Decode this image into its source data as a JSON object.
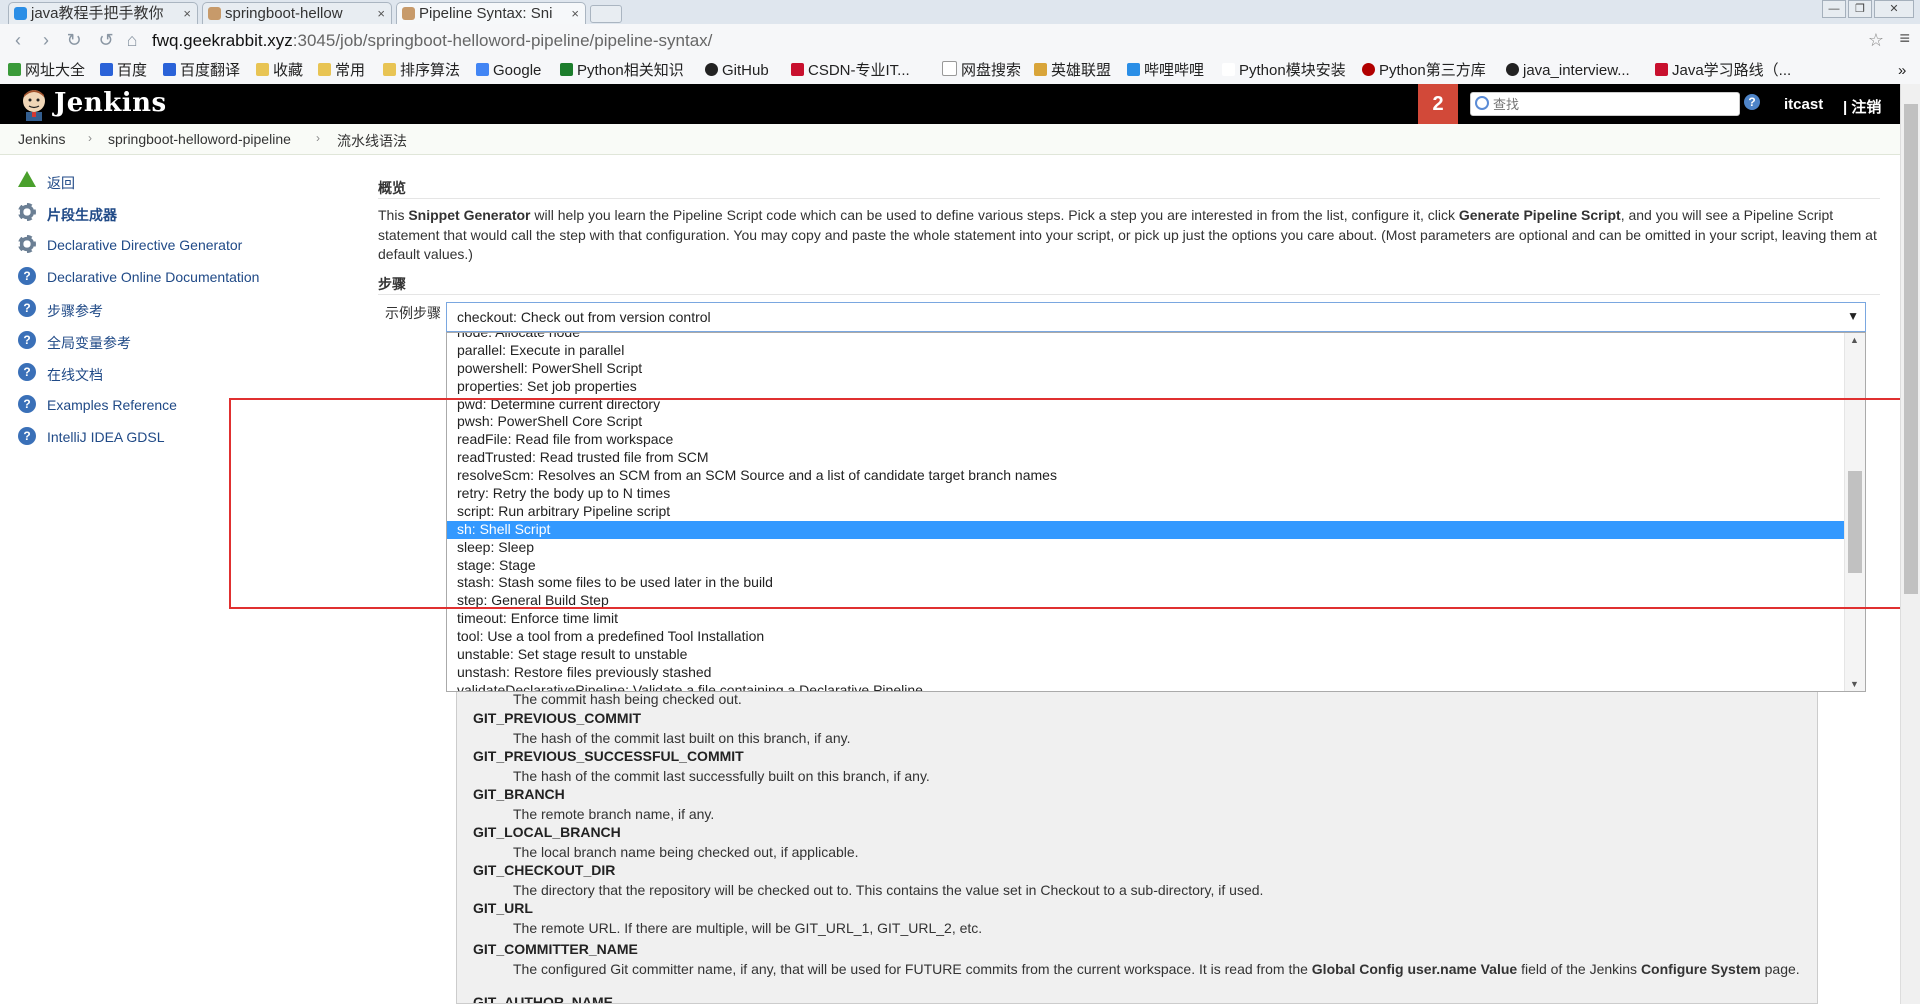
{
  "browser": {
    "tabs": [
      {
        "title": "java教程手把手教你"
      },
      {
        "title": "springboot-hellow"
      },
      {
        "title": "Pipeline Syntax: Sni"
      }
    ],
    "tab_close": "×",
    "url_host": "fwq.geekrabbit.xyz",
    "url_path": ":3045/job/springboot-helloword-pipeline/pipeline-syntax/",
    "bookmarks": [
      "网址大全",
      "百度",
      "百度翻译",
      "收藏",
      "常用",
      "排序算法",
      "Google",
      "Python相关知识",
      "GitHub",
      "CSDN-专业IT...",
      "网盘搜索",
      "英雄联盟",
      "哔哩哔哩",
      "Python模块安装",
      "Python第三方库",
      "java_interview...",
      "Java学习路线（..."
    ],
    "more": "»"
  },
  "header": {
    "title": "Jenkins",
    "notification_count": "2",
    "search_placeholder": "查找",
    "help": "?",
    "user": "itcast",
    "logout": "| 注销"
  },
  "breadcrumbs": [
    "Jenkins",
    "springboot-helloword-pipeline",
    "流水线语法"
  ],
  "sidebar": {
    "items": [
      {
        "label": "返回"
      },
      {
        "label": "片段生成器"
      },
      {
        "label": "Declarative Directive Generator"
      },
      {
        "label": "Declarative Online Documentation"
      },
      {
        "label": "步骤参考"
      },
      {
        "label": "全局变量参考"
      },
      {
        "label": "在线文档"
      },
      {
        "label": "Examples Reference"
      },
      {
        "label": "IntelliJ IDEA GDSL"
      }
    ]
  },
  "main": {
    "overview_heading": "概览",
    "desc_1": "This ",
    "desc_b1": "Snippet Generator",
    "desc_2": " will help you learn the Pipeline Script code which can be used to define various steps. Pick a step you are interested in from the list, configure it, click ",
    "desc_b2": "Generate Pipeline Script",
    "desc_3": ", and you will see a Pipeline Script statement that would call the step with that configuration. You may copy and paste the whole statement into your script, or pick up just the options you care about. (Most parameters are optional and can be omitted in your script, leaving them at default values.)",
    "steps_heading": "步骤",
    "step_label": "示例步骤",
    "selected_step": "checkout: Check out from version control",
    "dropdown_arrow": "▼",
    "dropdown_items": [
      "node: Allocate node",
      "parallel: Execute in parallel",
      "powershell: PowerShell Script",
      "properties: Set job properties",
      "pwd: Determine current directory",
      "pwsh: PowerShell Core Script",
      "readFile: Read file from workspace",
      "readTrusted: Read trusted file from SCM",
      "resolveScm: Resolves an SCM from an SCM Source and a list of candidate target branch names",
      "retry: Retry the body up to N times",
      "script: Run arbitrary Pipeline script",
      "sh: Shell Script",
      "sleep: Sleep",
      "stage: Stage",
      "stash: Stash some files to be used later in the build",
      "step: General Build Step",
      "timeout: Enforce time limit",
      "tool: Use a tool from a predefined Tool Installation",
      "unstable: Set stage result to unstable",
      "unstash: Restore files previously stashed",
      "validateDeclarativePipeline: Validate a file containing a Declarative Pipeline"
    ],
    "highlighted_item": "sh: Shell Script"
  },
  "help_vars": {
    "first_desc": "The commit hash being checked out.",
    "items": [
      {
        "name": "GIT_PREVIOUS_COMMIT",
        "desc": "The hash of the commit last built on this branch, if any."
      },
      {
        "name": "GIT_PREVIOUS_SUCCESSFUL_COMMIT",
        "desc": "The hash of the commit last successfully built on this branch, if any."
      },
      {
        "name": "GIT_BRANCH",
        "desc": "The remote branch name, if any."
      },
      {
        "name": "GIT_LOCAL_BRANCH",
        "desc": "The local branch name being checked out, if applicable."
      },
      {
        "name": "GIT_CHECKOUT_DIR",
        "desc": "The directory that the repository will be checked out to. This contains the value set in Checkout to a sub-directory, if used."
      },
      {
        "name": "GIT_URL",
        "desc": "The remote URL. If there are multiple, will be GIT_URL_1, GIT_URL_2, etc."
      }
    ],
    "committer_name": "GIT_COMMITTER_NAME",
    "committer_desc_1": "The configured Git committer name, if any, that will be used for FUTURE commits from the current workspace. It is read from the ",
    "committer_desc_b1": "Global Config user.name Value",
    "committer_desc_2": " field of the Jenkins ",
    "committer_desc_b2": "Configure System",
    "committer_desc_3": " page.",
    "last_name": "GIT_AUTHOR_NAME"
  },
  "colors": {
    "header_bg": "#000000",
    "badge": "#d24939",
    "selection": "#3399ff",
    "annotation_box": "#e03030",
    "link": "#204a87"
  }
}
